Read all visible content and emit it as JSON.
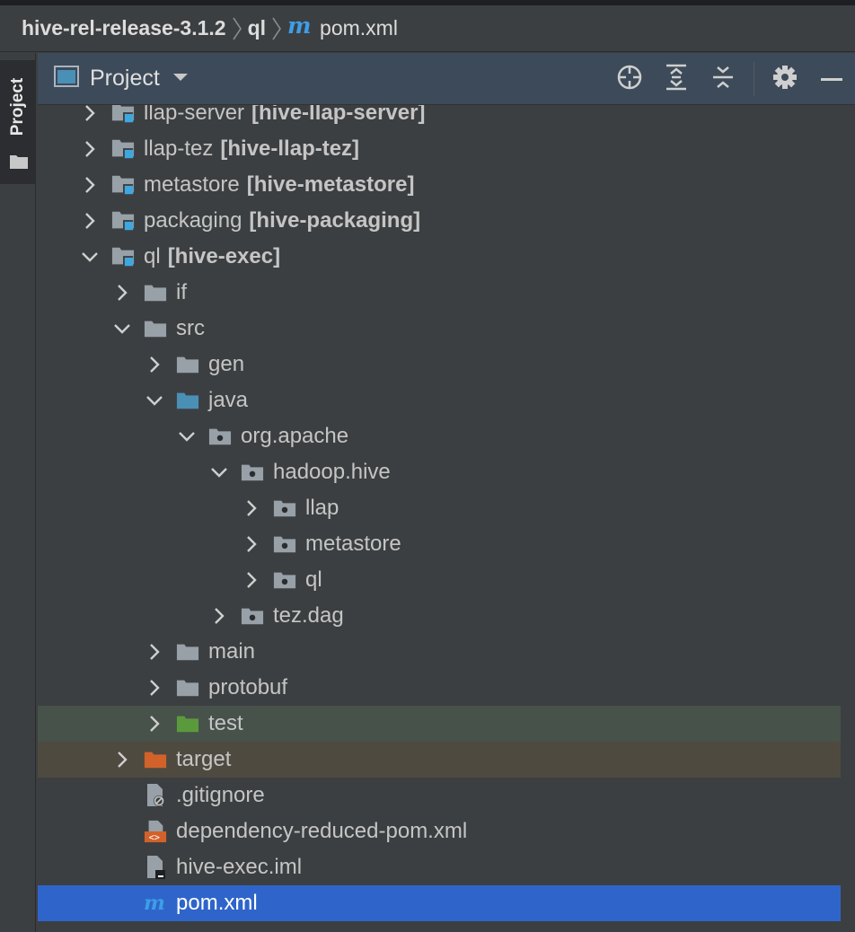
{
  "breadcrumbs": [
    "hive-rel-release-3.1.2",
    "ql",
    "pom.xml"
  ],
  "sidebar": {
    "tab_label": "Project"
  },
  "panel": {
    "title": "Project",
    "tools": [
      "locate-icon",
      "expand-all-icon",
      "collapse-all-icon",
      "gear-icon",
      "minimize-icon"
    ]
  },
  "tree": [
    {
      "label": "llap-server",
      "module": "[hive-llap-server]",
      "level": 0,
      "expanded": false,
      "icon": "module-folder-icon"
    },
    {
      "label": "llap-tez",
      "module": "[hive-llap-tez]",
      "level": 0,
      "expanded": false,
      "icon": "module-folder-icon"
    },
    {
      "label": "metastore",
      "module": "[hive-metastore]",
      "level": 0,
      "expanded": false,
      "icon": "module-folder-icon"
    },
    {
      "label": "packaging",
      "module": "[hive-packaging]",
      "level": 0,
      "expanded": false,
      "icon": "module-folder-icon"
    },
    {
      "label": "ql",
      "module": "[hive-exec]",
      "level": 0,
      "expanded": true,
      "icon": "module-folder-icon"
    },
    {
      "label": "if",
      "level": 1,
      "expanded": false,
      "icon": "folder-icon"
    },
    {
      "label": "src",
      "level": 1,
      "expanded": true,
      "icon": "folder-icon"
    },
    {
      "label": "gen",
      "level": 2,
      "expanded": false,
      "icon": "folder-icon"
    },
    {
      "label": "java",
      "level": 2,
      "expanded": true,
      "icon": "source-folder-icon"
    },
    {
      "label": "org.apache",
      "level": 3,
      "expanded": true,
      "icon": "package-icon"
    },
    {
      "label": "hadoop.hive",
      "level": 4,
      "expanded": true,
      "icon": "package-icon"
    },
    {
      "label": "llap",
      "level": 5,
      "expanded": false,
      "icon": "package-icon"
    },
    {
      "label": "metastore",
      "level": 5,
      "expanded": false,
      "icon": "package-icon"
    },
    {
      "label": "ql",
      "level": 5,
      "expanded": false,
      "icon": "package-icon"
    },
    {
      "label": "tez.dag",
      "level": 4,
      "expanded": false,
      "icon": "package-icon"
    },
    {
      "label": "main",
      "level": 2,
      "expanded": false,
      "icon": "folder-icon"
    },
    {
      "label": "protobuf",
      "level": 2,
      "expanded": false,
      "icon": "folder-icon"
    },
    {
      "label": "test",
      "level": 2,
      "expanded": false,
      "icon": "test-folder-icon",
      "highlight": "green"
    },
    {
      "label": "target",
      "level": 1,
      "expanded": false,
      "icon": "excluded-folder-icon",
      "highlight": "orange"
    },
    {
      "label": ".gitignore",
      "level": 1,
      "file": true,
      "icon": "ignore-file-icon"
    },
    {
      "label": "dependency-reduced-pom.xml",
      "level": 1,
      "file": true,
      "icon": "xml-file-icon"
    },
    {
      "label": "hive-exec.iml",
      "level": 1,
      "file": true,
      "icon": "iml-file-icon"
    },
    {
      "label": "pom.xml",
      "level": 1,
      "file": true,
      "icon": "maven-icon",
      "selected": true
    }
  ],
  "colors": {
    "background": "#3c3f41",
    "header": "#3d4a59",
    "selection": "#2f65ca",
    "test_row": "#46524a",
    "excluded_row": "#4e4a40",
    "module_badge": "#3fa7e0",
    "source_folder": "#4a8fb6",
    "test_folder": "#5b9a3c",
    "excluded_folder": "#d2622a",
    "maven": "#3d9ee6"
  }
}
